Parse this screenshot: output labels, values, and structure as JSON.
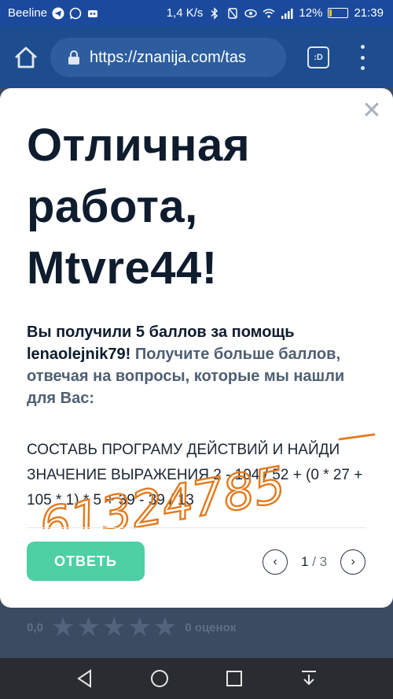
{
  "status_bar": {
    "carrier": "Beeline",
    "speed": "1,4 K/s",
    "battery": "12%",
    "battery_level": 0.12,
    "time": "21:39"
  },
  "browser": {
    "url": "https://znanija.com/tas",
    "tab_label": ":D",
    "icons": [
      "home-icon",
      "lock-icon",
      "tab-switcher-icon",
      "menu-icon"
    ]
  },
  "modal": {
    "title": "Отличная работа, Mtvre44!",
    "message_dark": "Вы получили 5 баллов за помощь lenaolejnik79!",
    "message_light": "Получите больше баллов, отвечая на вопросы, которые мы нашли для Вас:",
    "question": "СОСТАВЬ ПРОГРАМУ ДЕЙСТВИЙ И НАЙДИ ЗНАЧЕНИЕ ВЫРАЖЕНИЯ 2 - 104 / 52 + (0 * 27 + 105 * 1) * 5 + 39 - 39 / 13",
    "handwriting": "61324785",
    "answer_button": "ОТВЕТЬ",
    "pager": {
      "current": "1",
      "total": "/ 3"
    },
    "accent_color": "#4ecfa4"
  },
  "background": {
    "rating_value": "0,0",
    "rating_stars": 5,
    "rating_count": "0 оценок"
  }
}
